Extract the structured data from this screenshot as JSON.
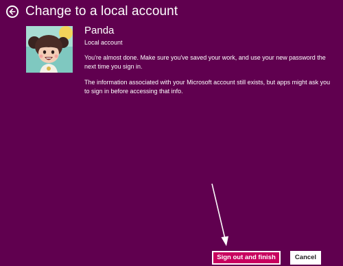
{
  "header": {
    "title": "Change to a local account",
    "back_icon": "back-arrow-circle-icon"
  },
  "account": {
    "name": "Panda",
    "type": "Local account",
    "avatar": "user-avatar-cartoon-girl"
  },
  "messages": {
    "p1": "You're almost done. Make sure you've saved your work, and use your new password the next time you sign in.",
    "p2": "The information associated with your Microsoft account still exists, but apps might ask you to sign in before accessing that info."
  },
  "actions": {
    "primary_label": "Sign out and finish",
    "cancel_label": "Cancel"
  },
  "colors": {
    "background": "#60004f",
    "primary_button": "#c8005f",
    "text": "#ffffff"
  }
}
